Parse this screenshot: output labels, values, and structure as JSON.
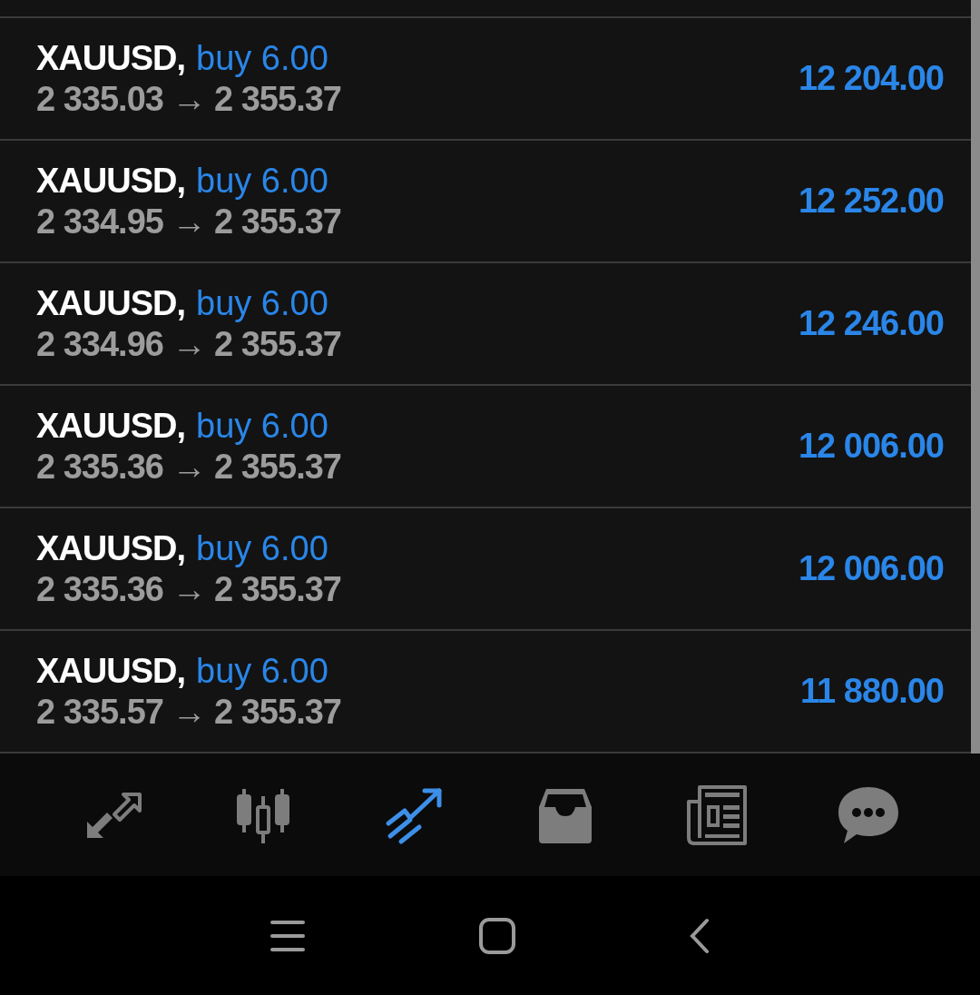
{
  "positions": [
    {
      "symbol": "XAUUSD,",
      "order": "buy 6.00",
      "prices": "2 335.03 → 2 355.37",
      "profit": "12 204.00"
    },
    {
      "symbol": "XAUUSD,",
      "order": "buy 6.00",
      "prices": "2 334.95 → 2 355.37",
      "profit": "12 252.00"
    },
    {
      "symbol": "XAUUSD,",
      "order": "buy 6.00",
      "prices": "2 334.96 → 2 355.37",
      "profit": "12 246.00"
    },
    {
      "symbol": "XAUUSD,",
      "order": "buy 6.00",
      "prices": "2 335.36 → 2 355.37",
      "profit": "12 006.00"
    },
    {
      "symbol": "XAUUSD,",
      "order": "buy 6.00",
      "prices": "2 335.36 → 2 355.37",
      "profit": "12 006.00"
    },
    {
      "symbol": "XAUUSD,",
      "order": "buy 6.00",
      "prices": "2 335.57 → 2 355.37",
      "profit": "11 880.00"
    }
  ],
  "bottom_nav": [
    {
      "kind": "quotes",
      "selected": false
    },
    {
      "kind": "chart",
      "selected": false
    },
    {
      "kind": "trade",
      "selected": true
    },
    {
      "kind": "history",
      "selected": false
    },
    {
      "kind": "news",
      "selected": false
    },
    {
      "kind": "messages",
      "selected": false
    }
  ]
}
